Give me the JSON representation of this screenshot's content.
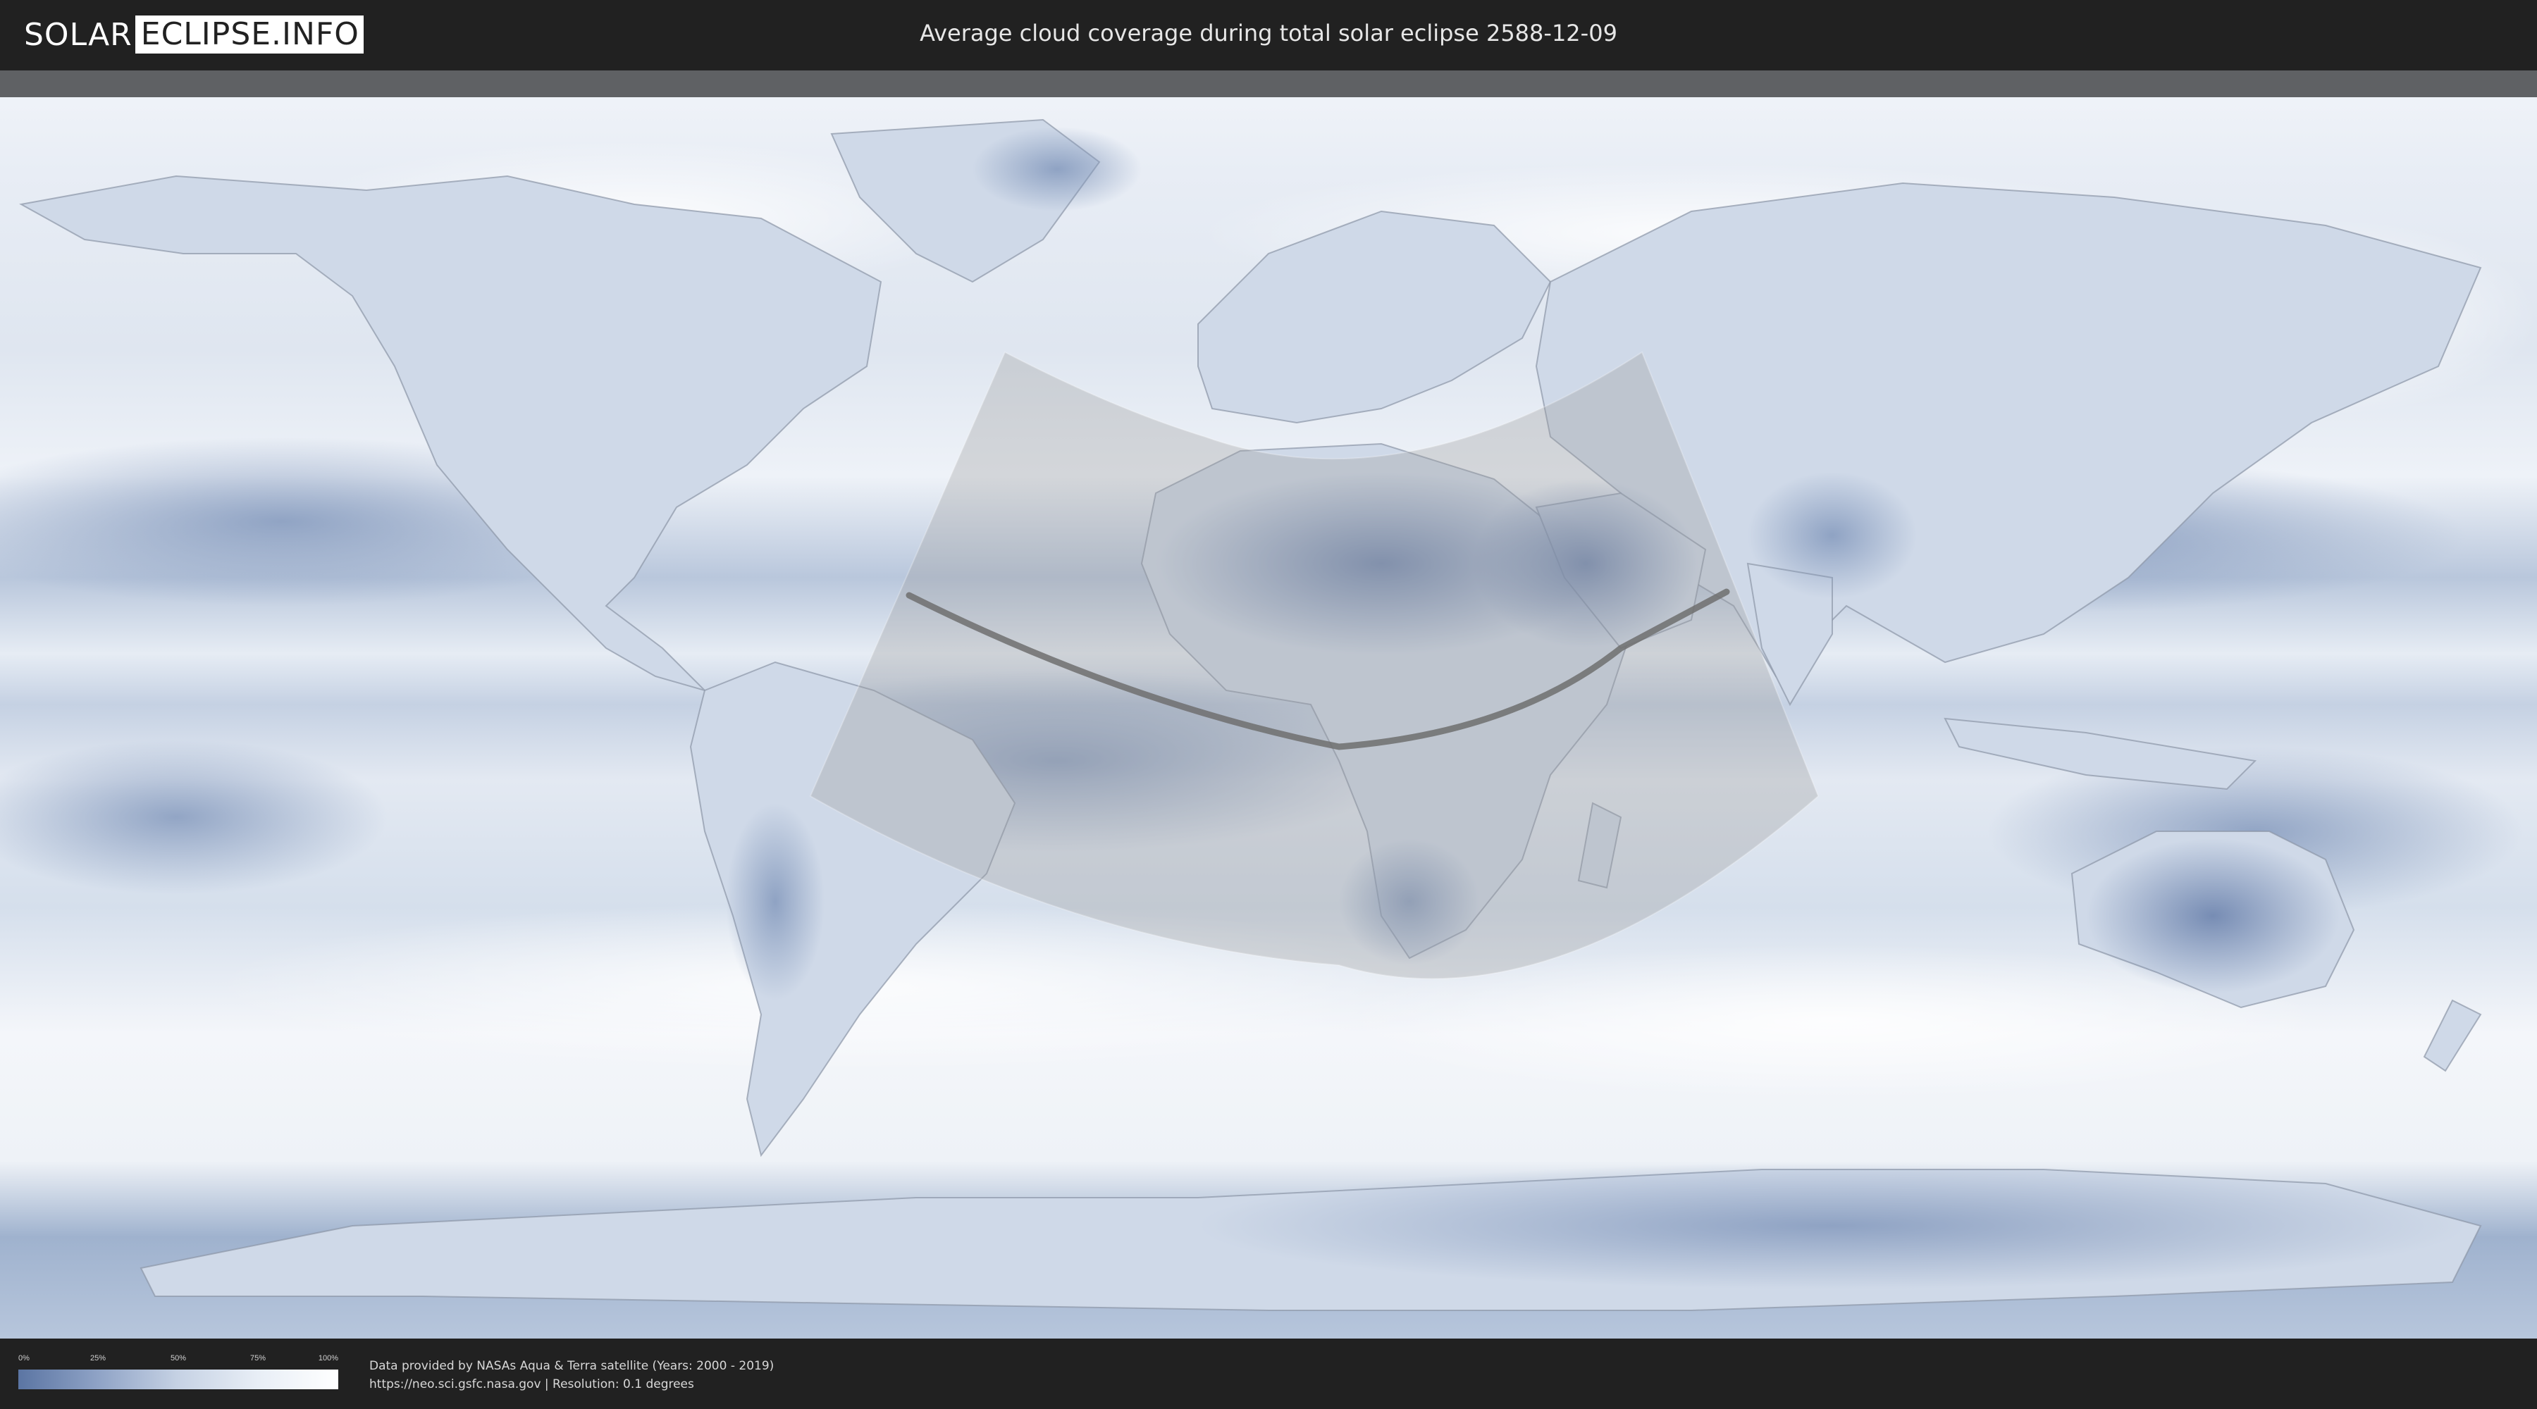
{
  "header": {
    "logo_part1": "SOLAR",
    "logo_part2": "ECLIPSE.INFO",
    "title": "Average cloud coverage during total solar eclipse 2588-12-09"
  },
  "map": {
    "background_color": "#e9eef5",
    "cloud_color_low": "#5b75a3",
    "cloud_color_high": "#ffffff",
    "eclipse_overlay_color": "#9a9a9a",
    "central_line_color": "#6e6e6e"
  },
  "legend": {
    "ticks": [
      "0%",
      "25%",
      "50%",
      "75%",
      "100%"
    ],
    "tick_values": [
      0,
      25,
      50,
      75,
      100
    ]
  },
  "footer": {
    "credit_line1": "Data provided by NASAs Aqua & Terra satellite (Years: 2000 - 2019)",
    "credit_line2": "https://neo.sci.gsfc.nasa.gov | Resolution: 0.1 degrees"
  }
}
